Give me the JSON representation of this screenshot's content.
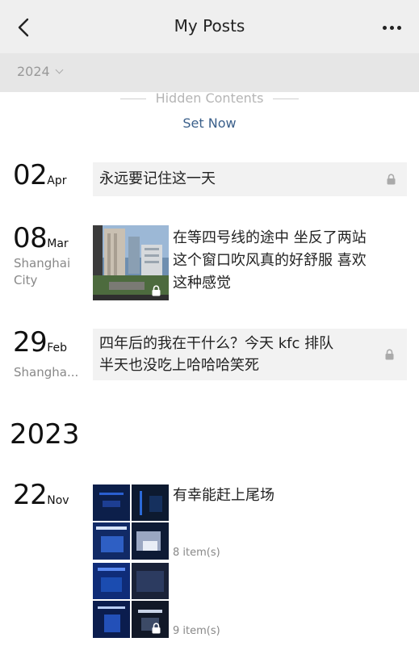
{
  "header": {
    "title": "My Posts"
  },
  "filter": {
    "year": "2024"
  },
  "hidden": {
    "label": "Hidden Contents",
    "action": "Set Now"
  },
  "posts2024": [
    {
      "day": "02",
      "month": "Apr",
      "location": "",
      "text": "永远要记住这一天"
    },
    {
      "day": "08",
      "month": "Mar",
      "location": "Shanghai City",
      "text_lines": [
        "在等四号线的途中 坐反了两站",
        "这个窗口吹风真的好舒服 喜欢",
        "这种感觉"
      ]
    },
    {
      "day": "29",
      "month": "Feb",
      "location": "Shangha...",
      "text_lines": [
        "四年后的我在干什么？今天 kfc 排队",
        "半天也没吃上哈哈哈笑死"
      ]
    }
  ],
  "year2023": {
    "heading": "2023"
  },
  "posts2023": [
    {
      "day": "22",
      "month": "Nov",
      "text": "有幸能赶上尾场",
      "album_counts": [
        "8 item(s)",
        "9 item(s)"
      ]
    }
  ],
  "colors": {
    "accent_link": "#3a5f8a",
    "card_bg": "#f2f2f2",
    "header_bg": "#efefef"
  }
}
